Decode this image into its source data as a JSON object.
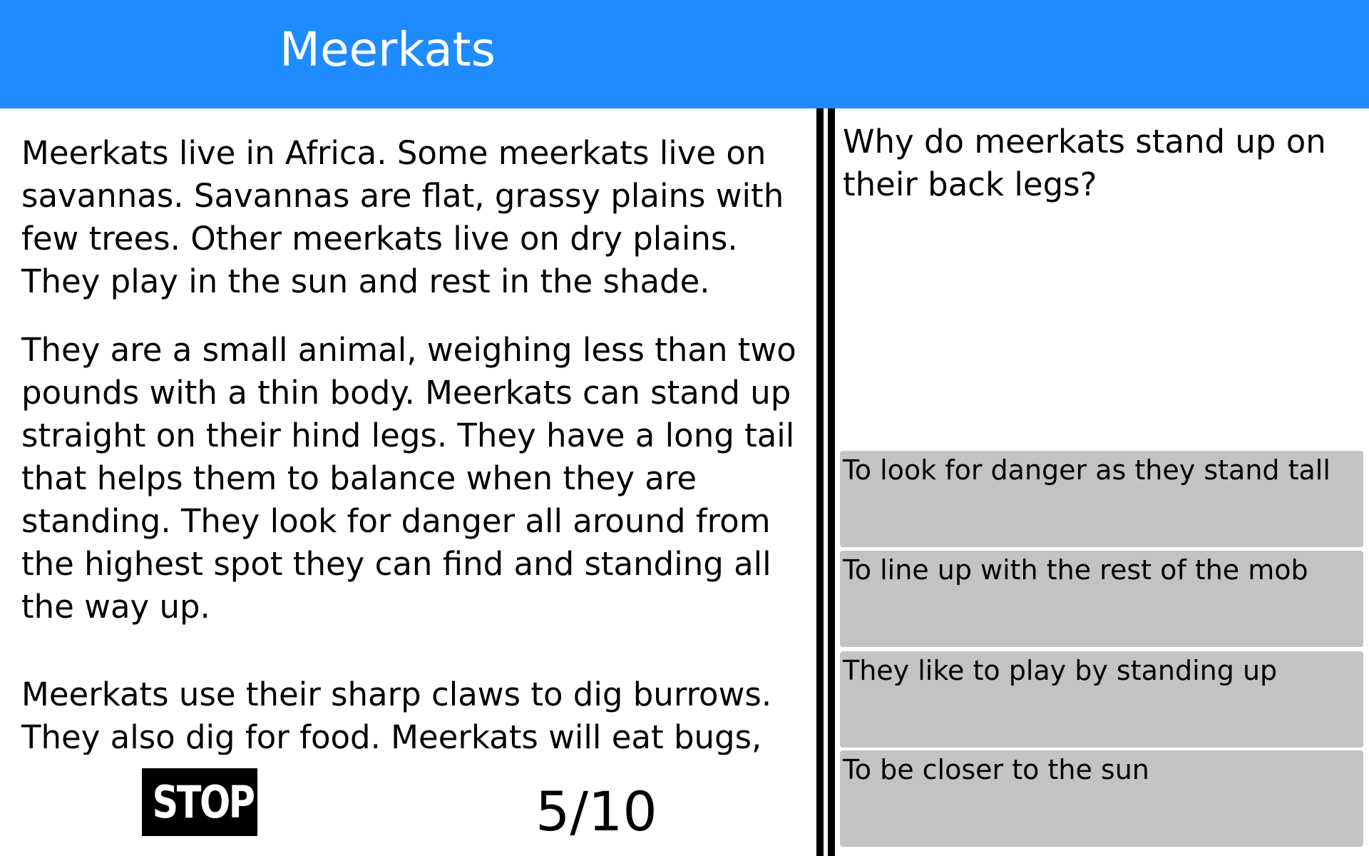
{
  "header": {
    "title": "Meerkats",
    "color": "#1e8cff"
  },
  "passage": {
    "paragraphs": [
      "Meerkats live in Africa. Some meerkats live on savannas. Savannas are flat, grassy plains with few trees. Other meerkats live on dry plains. They play in the sun and rest in the shade.",
      "They are a small animal, weighing less than two pounds with a thin body. Meerkats can stand up straight on their hind legs. They have a long tail that helps them to balance when they are standing. They look for danger all around from the highest spot they can find and standing all the way up.",
      "Meerkats use their sharp claws to dig burrows. They also dig for food. Meerkats will eat bugs,"
    ]
  },
  "question": {
    "text": "Why do meerkats stand up on their back legs?"
  },
  "answers": [
    {
      "label": "To look for danger as they stand tall"
    },
    {
      "label": "To line up with the rest of the mob"
    },
    {
      "label": "They like to play by standing up"
    },
    {
      "label": "To be closer to the sun"
    }
  ],
  "footer": {
    "stop_label": "STOP",
    "progress": "5/10"
  }
}
